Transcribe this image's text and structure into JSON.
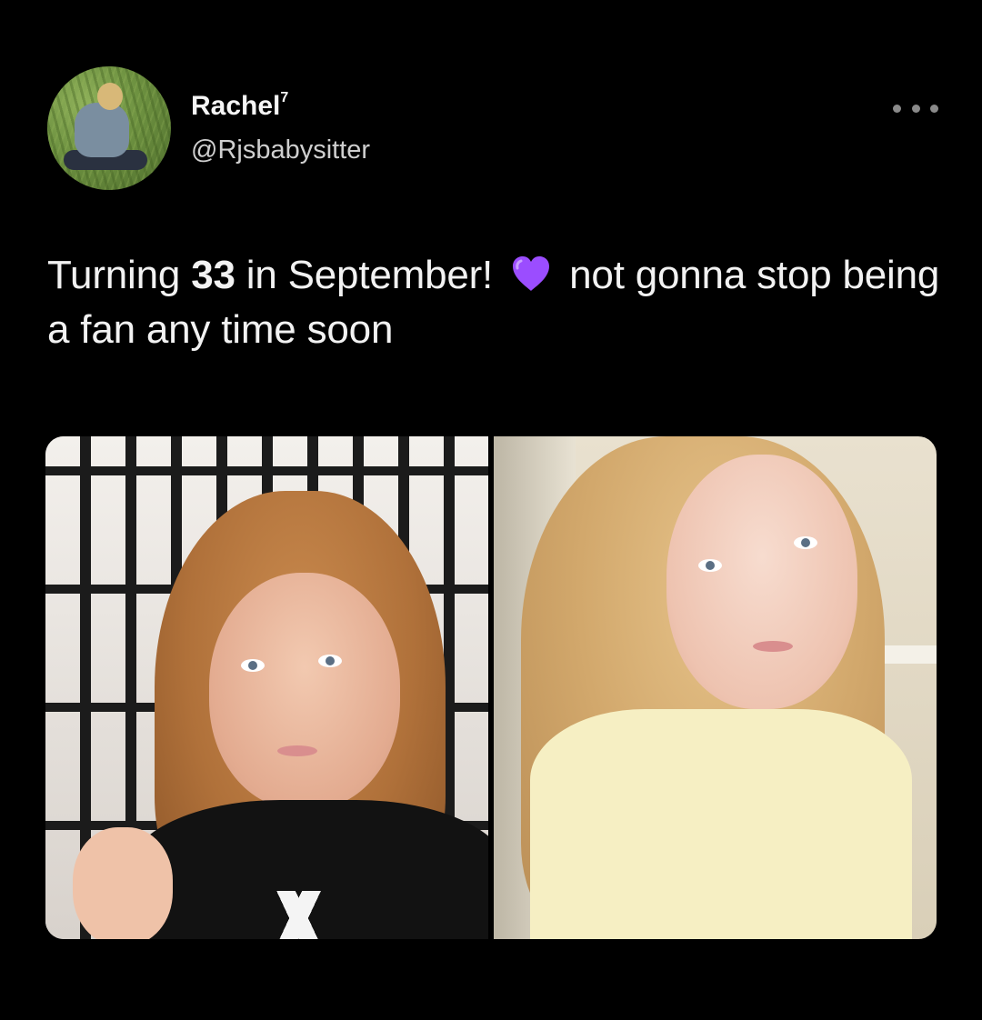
{
  "tweet": {
    "author": {
      "display_name": "Rachel",
      "name_superscript": "7",
      "handle": "@Rjsbabysitter",
      "avatar_icon": "profile-photo"
    },
    "more_icon": "more-horizontal-icon",
    "text": {
      "part1": "Turning ",
      "bold": "33",
      "part2": " in September! ",
      "emoji": "purple-heart",
      "part3": " not gonna stop being a fan any time soon"
    },
    "media": [
      {
        "kind": "photo",
        "subject": "left-selfie"
      },
      {
        "kind": "photo",
        "subject": "right-selfie"
      }
    ],
    "colors": {
      "background": "#000000",
      "text": "#f2f2f2",
      "handle": "#cfcfcf",
      "heart": "#9b4dff"
    }
  }
}
